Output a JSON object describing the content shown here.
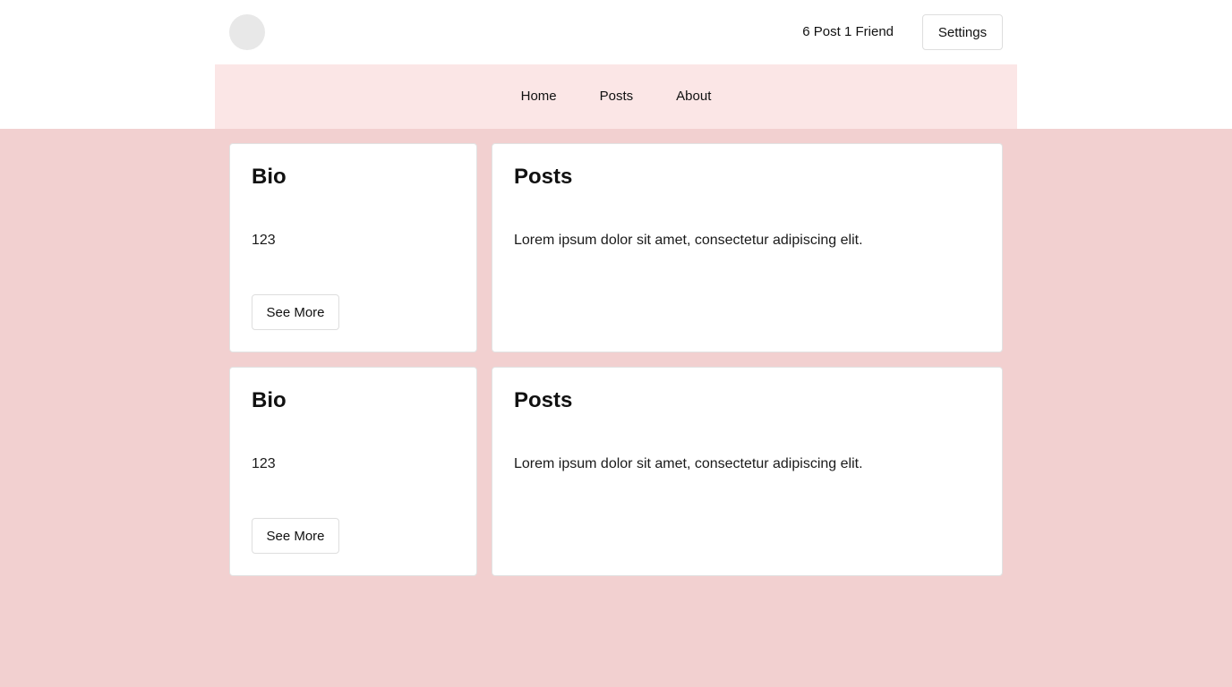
{
  "header": {
    "stats": "6 Post 1 Friend",
    "settings_label": "Settings"
  },
  "nav": {
    "items": [
      {
        "label": "Home"
      },
      {
        "label": "Posts"
      },
      {
        "label": "About"
      }
    ]
  },
  "rows": [
    {
      "bio": {
        "title": "Bio",
        "text": "123",
        "button": "See More"
      },
      "posts": {
        "title": "Posts",
        "text": "Lorem ipsum dolor sit amet, consectetur adipiscing elit."
      }
    },
    {
      "bio": {
        "title": "Bio",
        "text": "123",
        "button": "See More"
      },
      "posts": {
        "title": "Posts",
        "text": "Lorem ipsum dolor sit amet, consectetur adipiscing elit."
      }
    }
  ],
  "colors": {
    "page_background": "#f2d0d0",
    "nav_background": "#fbe6e6",
    "card_background": "#ffffff",
    "avatar": "#e8e8e8"
  }
}
